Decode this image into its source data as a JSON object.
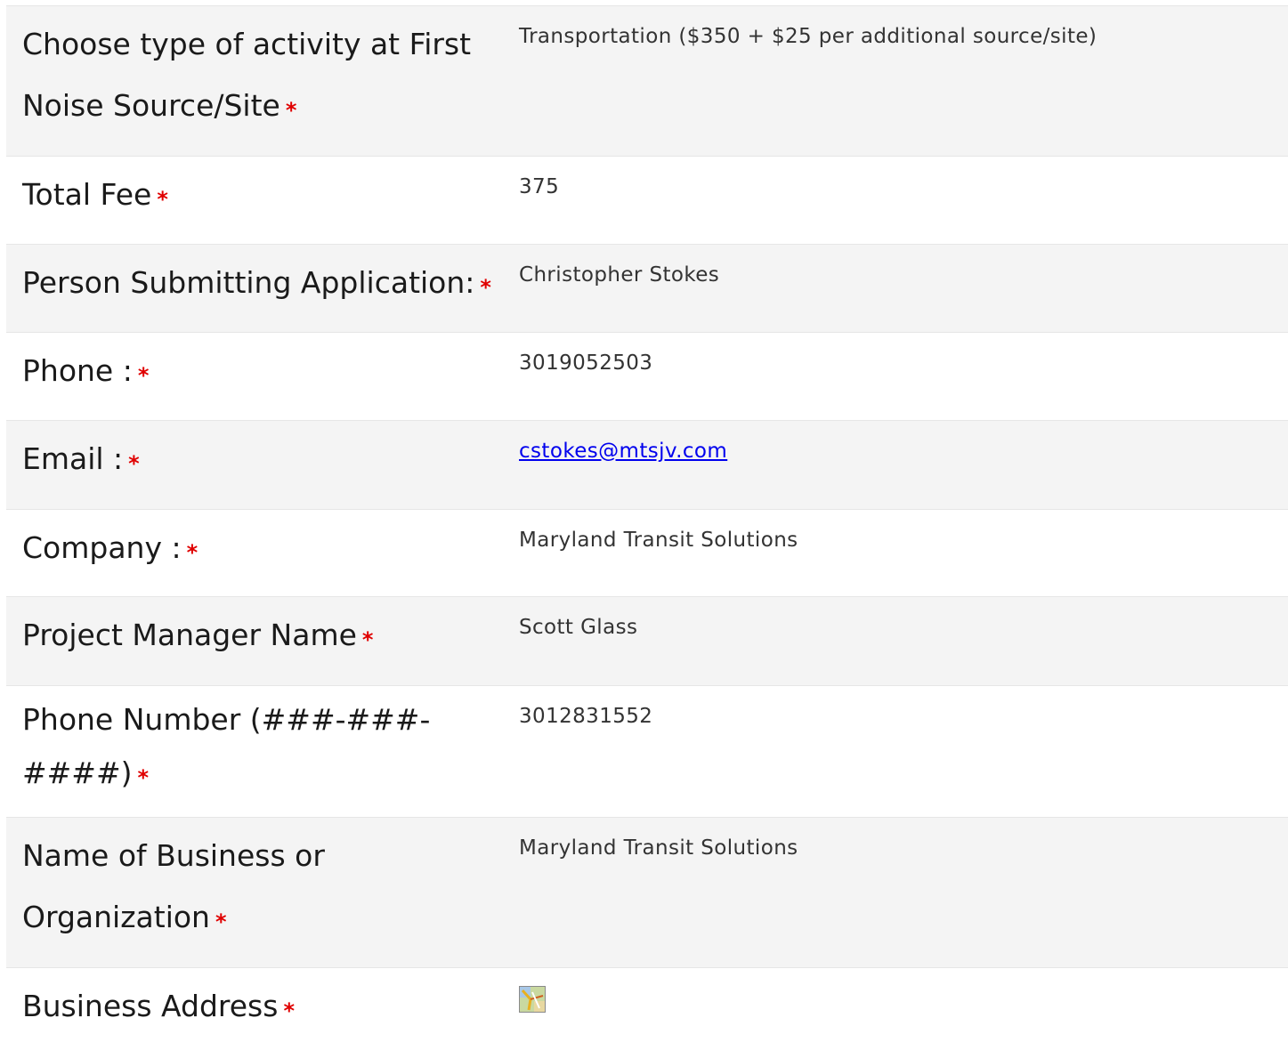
{
  "rows": [
    {
      "label": "Choose type of activity at First Noise Source/Site",
      "value": "Transportation ($350 + $25 per additional source/site)"
    },
    {
      "label": "Total Fee",
      "value": "375"
    },
    {
      "label": "Person Submitting Application:",
      "value": "Christopher Stokes"
    },
    {
      "label": "Phone :",
      "value": "3019052503"
    },
    {
      "label": "Email :",
      "value": "cstokes@mtsjv.com"
    },
    {
      "label": "Company :",
      "value": "Maryland Transit Solutions"
    },
    {
      "label": "Project Manager Name",
      "value": "Scott Glass"
    },
    {
      "label": "Phone Number (###-###-####)",
      "value": "3012831552"
    },
    {
      "label": "Name of Business or Organization",
      "value": "Maryland Transit Solutions"
    },
    {
      "label": "Business Address",
      "value_icon": "map-icon"
    }
  ],
  "required_marker": "*",
  "colors": {
    "required": "#e00000",
    "row_shaded": "#f4f4f4",
    "row_plain": "#ffffff",
    "link": "#0000ee"
  }
}
